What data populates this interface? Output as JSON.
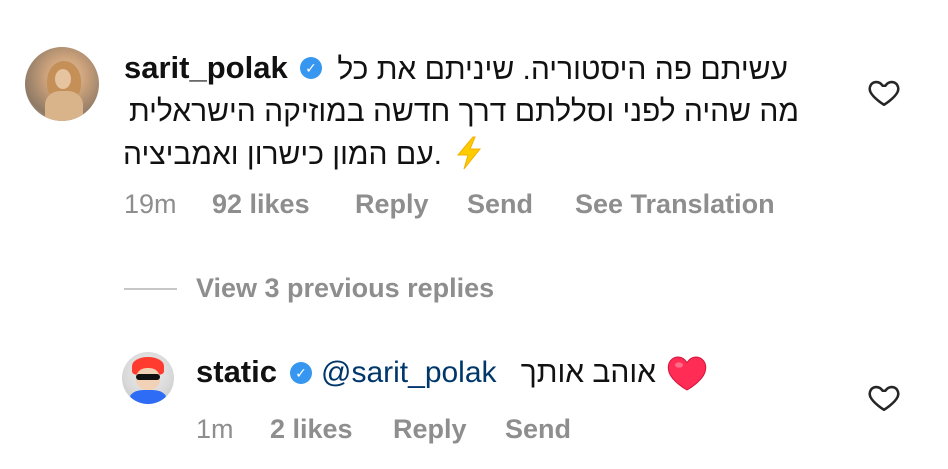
{
  "comments": [
    {
      "username": "sarit_polak",
      "text_lines": [
        "עשיתם פה היסטוריה. שיניתם את כל",
        "מה שהיה לפני  וסללתם דרך חדשה במוזיקה הישראלית",
        ".עם המון כישרון ואמביציה"
      ],
      "time": "19m",
      "likes": "92 likes",
      "reply": "Reply",
      "send": "Send",
      "see_translation": "See Translation"
    }
  ],
  "view_previous_replies": "View 3 previous replies",
  "reply_comment": {
    "username": "static",
    "mention": "@sarit_polak",
    "text": "אוהב אותך",
    "time": "1m",
    "likes": "2 likes",
    "reply": "Reply",
    "send": "Send"
  },
  "icons": {
    "verified": "verified-badge-icon",
    "like": "heart-outline-icon",
    "emoji_lightning": "lightning-emoji",
    "emoji_heart": "red-heart-emoji"
  },
  "colors": {
    "verified": "#3797f0",
    "meta_text": "#8e8e8e",
    "mention": "#00376b",
    "heart_emoji": "#ff2d55"
  }
}
